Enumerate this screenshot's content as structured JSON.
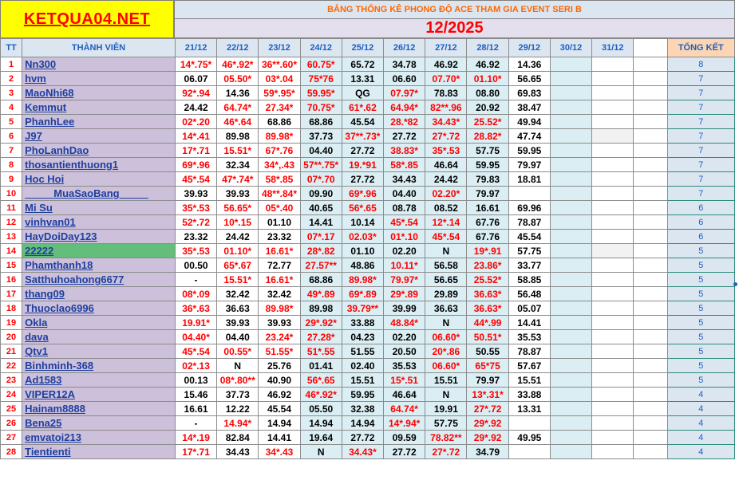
{
  "logo": "KETQUA04.NET",
  "banner": "BẢNG THỐNG KÊ PHONG ĐỘ ACE THAM GIA EVENT SERI B",
  "month": "12/2025",
  "headers": {
    "tt": "TT",
    "member": "THÀNH VIÊN",
    "dates": [
      "21/12",
      "22/12",
      "23/12",
      "24/12",
      "25/12",
      "26/12",
      "27/12",
      "28/12",
      "29/12",
      "30/12",
      "31/12"
    ],
    "total": "TỔNG KẾT"
  },
  "rows": [
    {
      "tt": "1",
      "name": "Nn300",
      "vals": [
        "14*.75*",
        "46*.92*",
        "36**.60*",
        "60.75*",
        "65.72",
        "34.78",
        "46.92",
        "46.92",
        "14.36"
      ],
      "red": [
        1,
        1,
        1,
        1,
        0,
        0,
        0,
        0,
        0
      ],
      "total": "8"
    },
    {
      "tt": "2",
      "name": "hvm",
      "vals": [
        "06.07",
        "05.50*",
        "03*.04",
        "75*76",
        "13.31",
        "06.60",
        "07.70*",
        "01.10*",
        "56.65"
      ],
      "red": [
        0,
        1,
        1,
        1,
        0,
        0,
        1,
        1,
        0
      ],
      "total": "7"
    },
    {
      "tt": "3",
      "name": "MaoNhi68",
      "vals": [
        "92*.94",
        "14.36",
        "59*.95*",
        "59.95*",
        "QG",
        "07.97*",
        "78.83",
        "08.80",
        "69.83"
      ],
      "red": [
        1,
        0,
        1,
        1,
        0,
        1,
        0,
        0,
        0
      ],
      "total": "7"
    },
    {
      "tt": "4",
      "name": "Kemmut",
      "vals": [
        "24.42",
        "64.74*",
        "27.34*",
        "70.75*",
        "61*.62",
        "64.94*",
        "82**.96",
        "20.92",
        "38.47"
      ],
      "red": [
        0,
        1,
        1,
        1,
        1,
        1,
        1,
        0,
        0
      ],
      "total": "7"
    },
    {
      "tt": "5",
      "name": "PhanhLee",
      "vals": [
        "02*.20",
        "46*.64",
        "68.86",
        "68.86",
        "45.54",
        "28.*82",
        "34.43*",
        "25.52*",
        "49.94"
      ],
      "red": [
        1,
        1,
        0,
        0,
        0,
        1,
        1,
        1,
        0
      ],
      "total": "7"
    },
    {
      "tt": "6",
      "name": "J97",
      "vals": [
        "14*.41",
        "89.98",
        "89.98*",
        "37.73",
        "37**.73*",
        "27.72",
        "27*.72",
        "28.82*",
        "47.74"
      ],
      "red": [
        1,
        0,
        1,
        0,
        1,
        0,
        1,
        1,
        0
      ],
      "total": "7"
    },
    {
      "tt": "7",
      "name": "PhoLanhDao",
      "vals": [
        "17*.71",
        "15.51*",
        "67*.76",
        "04.40",
        "27.72",
        "38.83*",
        "35*.53",
        "57.75",
        "59.95"
      ],
      "red": [
        1,
        1,
        1,
        0,
        0,
        1,
        1,
        0,
        0
      ],
      "total": "7"
    },
    {
      "tt": "8",
      "name": "thosantienthuong1",
      "vals": [
        "69*.96",
        "32.34",
        "34*,.43",
        "57**.75*",
        "19.*91",
        "58*.85",
        "46.64",
        "59.95",
        "79.97"
      ],
      "red": [
        1,
        0,
        1,
        1,
        1,
        1,
        0,
        0,
        0
      ],
      "total": "7"
    },
    {
      "tt": "9",
      "name": "Hoc Hoi",
      "vals": [
        "45*.54",
        "47*.74*",
        "58*.85",
        "07*.70",
        "27.72",
        "34.43",
        "24.42",
        "79.83",
        "18.81"
      ],
      "red": [
        1,
        1,
        1,
        1,
        0,
        0,
        0,
        0,
        0
      ],
      "total": "7"
    },
    {
      "tt": "10",
      "name": "_____MuaSaoBang_____",
      "vals": [
        "39.93",
        "39.93",
        "48**.84*",
        "09.90",
        "69*.96",
        "04.40",
        "02.20*",
        "79.97",
        ""
      ],
      "red": [
        0,
        0,
        1,
        0,
        1,
        0,
        1,
        0,
        0
      ],
      "total": "7"
    },
    {
      "tt": "11",
      "name": "Mi Su",
      "vals": [
        "35*.53",
        "56.65*",
        "05*.40",
        "40.65",
        "56*.65",
        "08.78",
        "08.52",
        "16.61",
        "69.96"
      ],
      "red": [
        1,
        1,
        1,
        0,
        1,
        0,
        0,
        0,
        0
      ],
      "total": "6"
    },
    {
      "tt": "12",
      "name": "vinhvan01",
      "vals": [
        "52*.72",
        "10*.15",
        "01.10",
        "14.41",
        "10.14",
        "45*.54",
        "12*.14",
        "67.76",
        "78.87"
      ],
      "red": [
        1,
        1,
        0,
        0,
        0,
        1,
        1,
        0,
        0
      ],
      "total": "6"
    },
    {
      "tt": "13",
      "name": "HayDoiDay123",
      "vals": [
        "23.32",
        "24.42",
        "23.32",
        "07*.17",
        "02.03*",
        "01*.10",
        "45*.54",
        "67.76",
        "45.54"
      ],
      "red": [
        0,
        0,
        0,
        1,
        1,
        1,
        1,
        0,
        0
      ],
      "total": "6"
    },
    {
      "tt": "14",
      "name": "22222",
      "vals": [
        "35*.53",
        "01.10*",
        "16.61*",
        "28*.82",
        "01.10",
        "02.20",
        "N",
        "19*.91",
        "57.75"
      ],
      "red": [
        1,
        1,
        1,
        1,
        0,
        0,
        0,
        1,
        0
      ],
      "total": "5"
    },
    {
      "tt": "15",
      "name": "Phamthanh18",
      "vals": [
        "00.50",
        "65*.67",
        "72.77",
        "27.57**",
        "48.86",
        "10.11*",
        "56.58",
        "23.86*",
        "33.77"
      ],
      "red": [
        0,
        1,
        0,
        1,
        0,
        1,
        0,
        1,
        0
      ],
      "total": "5"
    },
    {
      "tt": "16",
      "name": "Satthuhoahong6677",
      "vals": [
        "-",
        "15.51*",
        "16.61*",
        "68.86",
        "89.98*",
        "79.97*",
        "56.65",
        "25.52*",
        "58.85"
      ],
      "red": [
        0,
        1,
        1,
        0,
        1,
        1,
        0,
        1,
        0
      ],
      "total": "5"
    },
    {
      "tt": "17",
      "name": "thang09",
      "vals": [
        "08*.09",
        "32.42",
        "32.42",
        "49*.89",
        "69*.89",
        "29*.89",
        "29.89",
        "36.63*",
        "56.48"
      ],
      "red": [
        1,
        0,
        0,
        1,
        1,
        1,
        0,
        1,
        0
      ],
      "total": "5"
    },
    {
      "tt": "18",
      "name": "Thuoclao6996",
      "vals": [
        "36*.63",
        "36.63",
        "89.98*",
        "89.98",
        "39.79**",
        "39.99",
        "36.63",
        "36.63*",
        "05.07"
      ],
      "red": [
        1,
        0,
        1,
        0,
        1,
        0,
        0,
        1,
        0
      ],
      "total": "5"
    },
    {
      "tt": "19",
      "name": "Okla",
      "vals": [
        "19.91*",
        "39.93",
        "39.93",
        "29*.92*",
        "33.88",
        "48.84*",
        "N",
        "44*.99",
        "14.41"
      ],
      "red": [
        1,
        0,
        0,
        1,
        0,
        1,
        0,
        1,
        0
      ],
      "total": "5"
    },
    {
      "tt": "20",
      "name": "dava",
      "vals": [
        "04.40*",
        "04.40",
        "23.24*",
        "27.28*",
        "04.23",
        "02.20",
        "06.60*",
        "50.51*",
        "35.53"
      ],
      "red": [
        1,
        0,
        1,
        1,
        0,
        0,
        1,
        1,
        0
      ],
      "total": "5"
    },
    {
      "tt": "21",
      "name": "Qtv1",
      "vals": [
        "45*.54",
        "00.55*",
        "51.55*",
        "51*.55",
        "51.55",
        "20.50",
        "20*.86",
        "50.55",
        "78.87"
      ],
      "red": [
        1,
        1,
        1,
        1,
        0,
        0,
        1,
        0,
        0
      ],
      "total": "5"
    },
    {
      "tt": "22",
      "name": "Binhminh-368",
      "vals": [
        "02*.13",
        "N",
        "25.76",
        "01.41",
        "02.40",
        "35.53",
        "06.60*",
        "65*75",
        "57.67"
      ],
      "red": [
        1,
        0,
        0,
        0,
        0,
        0,
        1,
        1,
        0
      ],
      "total": "5"
    },
    {
      "tt": "23",
      "name": "Ad1583",
      "vals": [
        "00.13",
        "08*.80**",
        "40.90",
        "56*.65",
        "15.51",
        "15*.51",
        "15.51",
        "79.97",
        "15.51"
      ],
      "red": [
        0,
        1,
        0,
        1,
        0,
        1,
        0,
        0,
        0
      ],
      "total": "5"
    },
    {
      "tt": "24",
      "name": "VIPER12A",
      "vals": [
        "15.46",
        "37.73",
        "46.92",
        "46*.92*",
        "59.95",
        "46.64",
        "N",
        "13*.31*",
        "33.88"
      ],
      "red": [
        0,
        0,
        0,
        1,
        0,
        0,
        0,
        1,
        0
      ],
      "total": "4"
    },
    {
      "tt": "25",
      "name": "Hainam8888",
      "vals": [
        "16.61",
        "12.22",
        "45.54",
        "05.50",
        "32.38",
        "64.74*",
        "19.91",
        "27*.72",
        "13.31"
      ],
      "red": [
        0,
        0,
        0,
        0,
        0,
        1,
        0,
        1,
        0
      ],
      "total": "4"
    },
    {
      "tt": "26",
      "name": "Bena25",
      "vals": [
        "-",
        "14.94*",
        "14.94",
        "14.94",
        "14.94",
        "14*.94*",
        "57.75",
        "29*.92",
        ""
      ],
      "red": [
        0,
        1,
        0,
        0,
        0,
        1,
        0,
        1,
        0
      ],
      "total": "4"
    },
    {
      "tt": "27",
      "name": "emvatoi213",
      "vals": [
        "14*.19",
        "82.84",
        "14.41",
        "19.64",
        "27.72",
        "09.59",
        "78.82**",
        "29*.92",
        "49.95"
      ],
      "red": [
        1,
        0,
        0,
        0,
        0,
        0,
        1,
        1,
        0
      ],
      "total": "4"
    },
    {
      "tt": "28",
      "name": "Tientienti",
      "vals": [
        "17*.71",
        "34.43",
        "34*.43",
        "N",
        "34.43*",
        "27.72",
        "27*.72",
        "34.79",
        ""
      ],
      "red": [
        1,
        0,
        1,
        0,
        1,
        0,
        1,
        0,
        0
      ],
      "total": "4"
    }
  ]
}
